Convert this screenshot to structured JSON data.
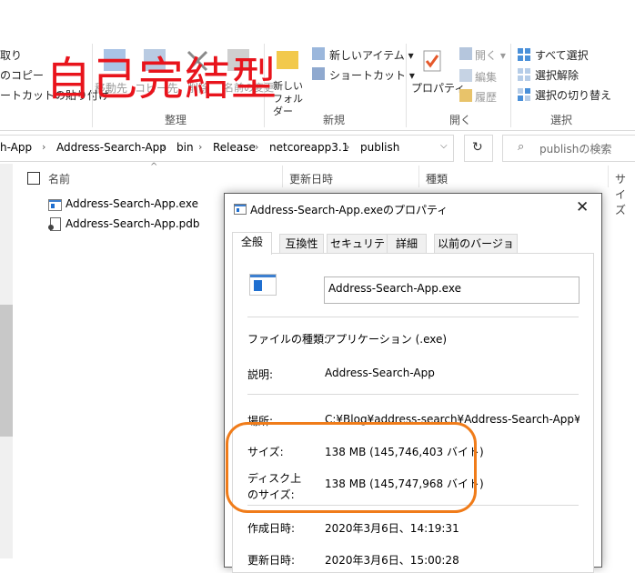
{
  "overlay_text": "自己完結型",
  "ribbon": {
    "clipboard": {
      "items": [
        "取り",
        "のコピー",
        "ートカットの貼り付け"
      ]
    },
    "organize": {
      "move_label": "移動先",
      "copy_label": "コピー先",
      "delete_label": "削除",
      "rename_label": "名前の変更",
      "group_label": "整理"
    },
    "new": {
      "new_folder_label": "新しい フォルダー",
      "new_item_label": "新しいアイテム ▾",
      "shortcut_label": "ショートカット ▾",
      "group_label": "新規"
    },
    "open": {
      "properties_label": "プロパティ",
      "open_label": "開く ▾",
      "edit_label": "編集",
      "history_label": "履歴",
      "group_label": "開く"
    },
    "select": {
      "select_all_label": "すべて選択",
      "select_none_label": "選択解除",
      "invert_label": "選択の切り替え",
      "group_label": "選択"
    }
  },
  "address": {
    "crumbs": [
      "h-App",
      "Address-Search-App",
      "bin",
      "Release",
      "netcoreapp3.1",
      "publish"
    ],
    "search_placeholder": "publishの検索"
  },
  "file_list": {
    "columns": [
      "名前",
      "更新日時",
      "種類",
      "サイズ"
    ],
    "files": [
      {
        "name": "Address-Search-App.exe",
        "icon": "exe-icon"
      },
      {
        "name": "Address-Search-App.pdb",
        "icon": "pdb-file-icon"
      }
    ]
  },
  "dialog": {
    "title": "Address-Search-App.exeのプロパティ",
    "tabs": [
      "全般",
      "互換性",
      "セキュリティ",
      "詳細",
      "以前のバージョン"
    ],
    "active_tab": "全般",
    "filename": "Address-Search-App.exe",
    "rows": {
      "type_label": "ファイルの種類:",
      "type_value": "アプリケーション (.exe)",
      "desc_label": "説明:",
      "desc_value": "Address-Search-App",
      "location_label": "場所:",
      "location_value": "C:¥Blog¥address-search¥Address-Search-App¥Addres",
      "size_label": "サイズ:",
      "size_value": "138 MB (145,746,403 バイト)",
      "disk_label_1": "ディスク上",
      "disk_label_2": "のサイズ:",
      "disk_value": "138 MB (145,747,968 バイト)",
      "created_label": "作成日時:",
      "created_value": "2020年3月6日、14:19:31",
      "modified_label": "更新日時:",
      "modified_value": "2020年3月6日、15:00:28"
    }
  },
  "colors": {
    "overlay_red": "#e8141c",
    "highlight_orange": "#f07c1a"
  }
}
